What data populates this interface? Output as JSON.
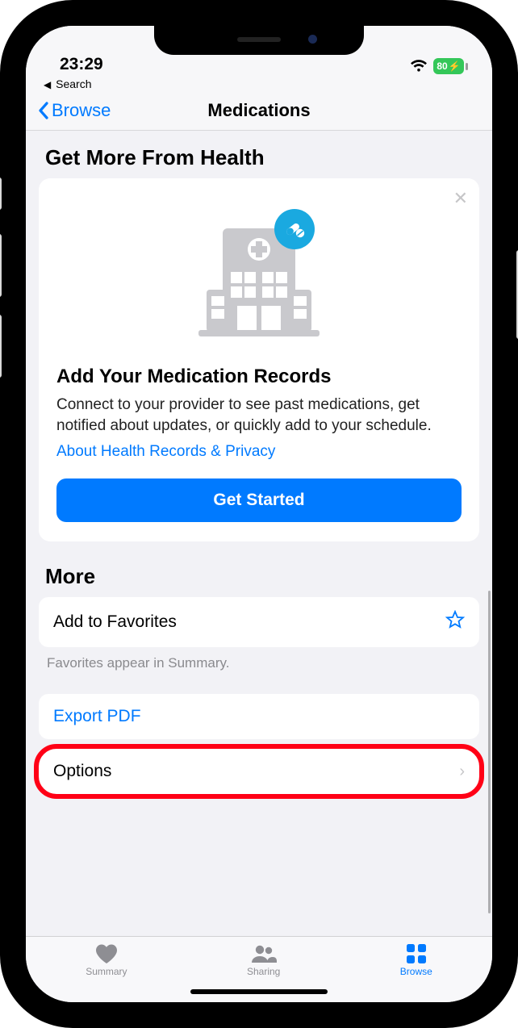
{
  "status": {
    "time": "23:29",
    "battery": "80"
  },
  "crumb": "Search",
  "nav": {
    "back": "Browse",
    "title": "Medications"
  },
  "promo": {
    "section_title": "Get More From Health",
    "heading": "Add Your Medication Records",
    "body": "Connect to your provider to see past medications, get notified about updates, or quickly add to your schedule.",
    "link": "About Health Records & Privacy",
    "cta": "Get Started"
  },
  "more": {
    "title": "More",
    "favorites_label": "Add to Favorites",
    "favorites_footnote": "Favorites appear in Summary.",
    "export_label": "Export PDF",
    "options_label": "Options"
  },
  "tabs": {
    "summary": "Summary",
    "sharing": "Sharing",
    "browse": "Browse"
  }
}
